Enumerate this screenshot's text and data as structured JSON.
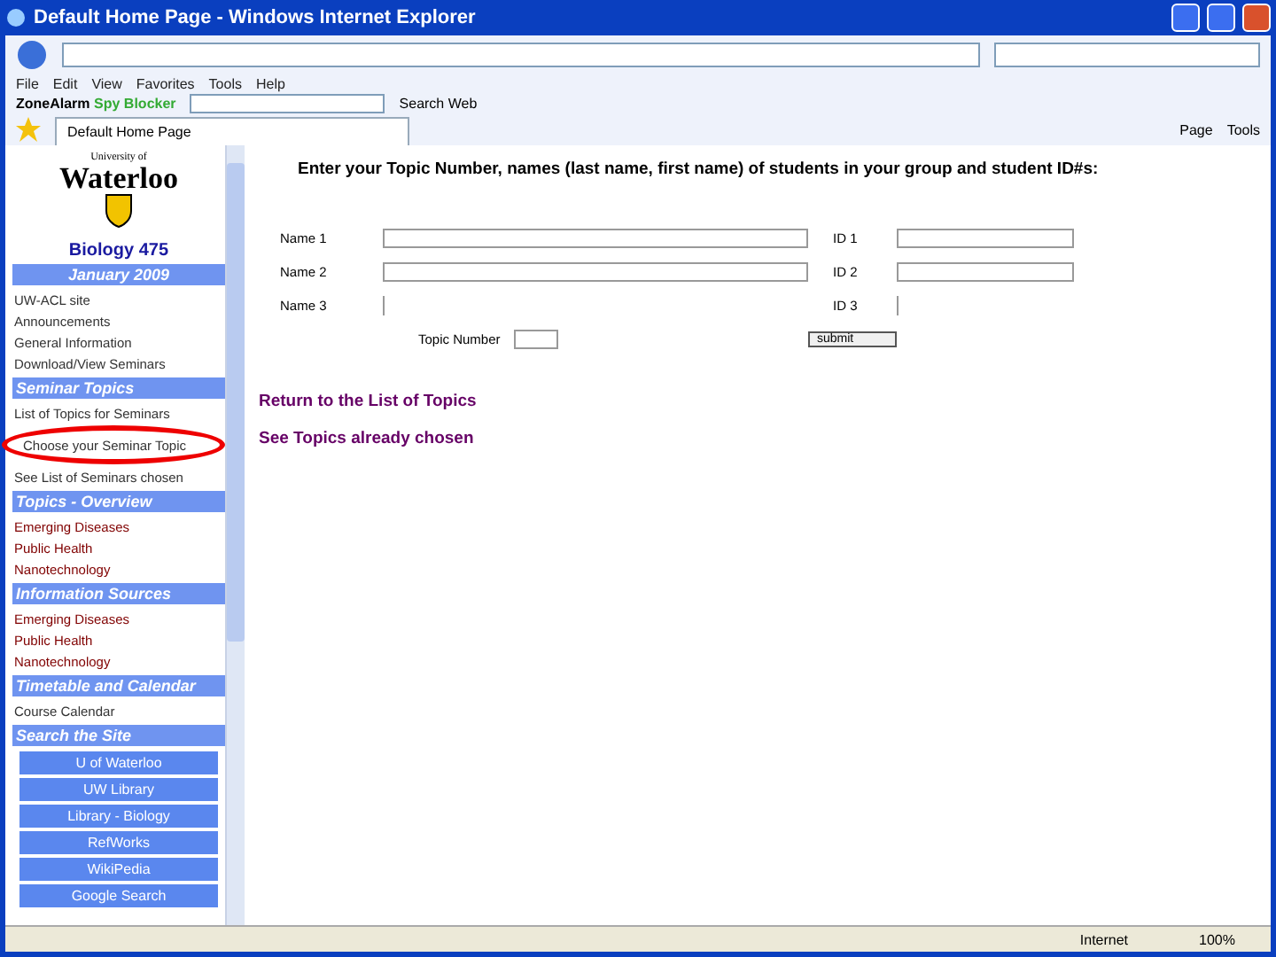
{
  "window": {
    "title": "Default Home Page - Windows Internet Explorer"
  },
  "menu": [
    "File",
    "Edit",
    "View",
    "Favorites",
    "Tools",
    "Help"
  ],
  "toolbar": {
    "brand": "ZoneAlarm",
    "brand_suffix": "Spy Blocker",
    "search_button": "Search Web"
  },
  "tab": {
    "label": "Default Home Page"
  },
  "command_bar": [
    "Page",
    "Tools"
  ],
  "sidebar": {
    "logo_top": "University of",
    "logo": "Waterloo",
    "course": "Biology 475",
    "term": "January 2009",
    "sections": [
      {
        "kind": "links",
        "items": [
          "UW-ACL site",
          "Announcements",
          "General Information",
          "Download/View Seminars"
        ]
      },
      {
        "kind": "heading",
        "label": "Seminar Topics"
      },
      {
        "kind": "links",
        "items": [
          "List of Topics for Seminars",
          "Choose your Seminar Topic",
          "See List of Seminars chosen"
        ]
      },
      {
        "kind": "heading",
        "label": "Topics - Overview"
      },
      {
        "kind": "links",
        "items": [
          "Emerging Diseases",
          "Public Health",
          "Nanotechnology"
        ]
      },
      {
        "kind": "heading",
        "label": "Information Sources"
      },
      {
        "kind": "links",
        "items": [
          "Emerging Diseases",
          "Public Health",
          "Nanotechnology"
        ]
      },
      {
        "kind": "heading",
        "label": "Timetable and Calendar"
      },
      {
        "kind": "links",
        "items": [
          "Course Calendar"
        ]
      },
      {
        "kind": "heading",
        "label": "Search the Site"
      },
      {
        "kind": "buttons",
        "items": [
          "U of Waterloo",
          "UW Library",
          "Library - Biology",
          "RefWorks",
          "WikiPedia",
          "Google Search"
        ]
      }
    ]
  },
  "form": {
    "heading": "Enter your Topic Number, names (last name, first name) of students in your group  and student ID#s:",
    "rows": [
      {
        "name_label": "Name 1",
        "id_label": "ID 1"
      },
      {
        "name_label": "Name 2",
        "id_label": "ID 2"
      },
      {
        "name_label": "Name 3",
        "id_label": "ID 3"
      }
    ],
    "topic_label": "Topic Number",
    "submit": "submit"
  },
  "links": [
    "Return to the List of Topics",
    "See Topics already chosen"
  ],
  "status_bar": {
    "zone": "Internet",
    "zoom": "100%"
  }
}
